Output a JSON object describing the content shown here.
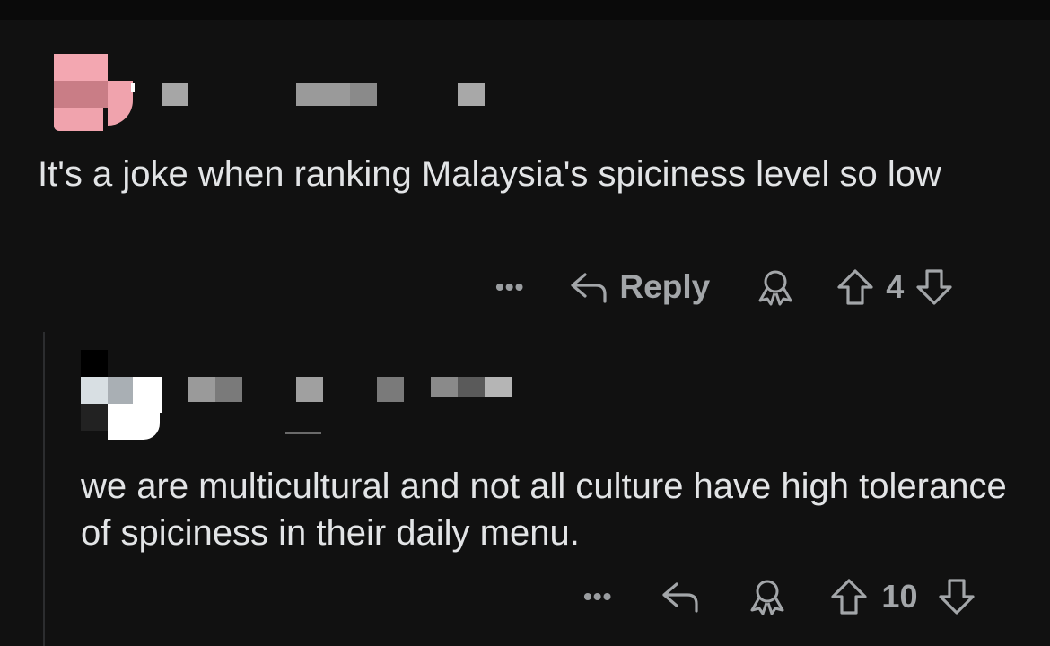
{
  "comments": [
    {
      "body": "It's a joke when ranking Malaysia's spiciness level so low",
      "more_label": "•••",
      "reply_label": "Reply",
      "score": "4"
    },
    {
      "body": "we are multicultural and not all culture have high tolerance of spiciness in their daily menu.",
      "more_label": "•••",
      "score": "10"
    }
  ],
  "icons": {
    "reply": "reply-arrow-icon",
    "award": "award-icon",
    "upvote": "upvote-arrow-icon",
    "downvote": "downvote-arrow-icon"
  },
  "colors": {
    "background": "#111111",
    "text": "#e2e4e6",
    "muted": "#a3a6a9",
    "avatar_pink": "#f0a3ad"
  }
}
